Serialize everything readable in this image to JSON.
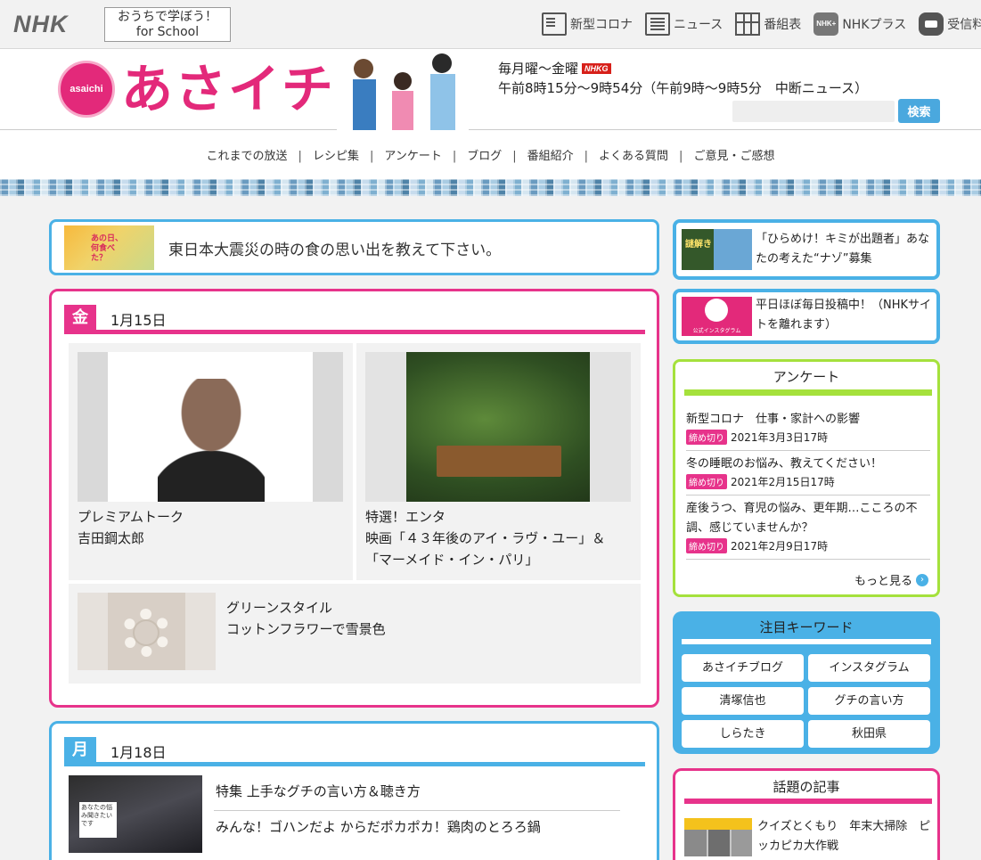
{
  "topbar": {
    "logo": "NHK",
    "school_line1": "おうちで学ぼう！",
    "school_line2": "for School",
    "nav": [
      {
        "label": "新型コロナ",
        "icon": "corona-info-icon"
      },
      {
        "label": "ニュース",
        "icon": "news-icon"
      },
      {
        "label": "番組表",
        "icon": "program-guide-icon"
      },
      {
        "label": "NHKプラス",
        "icon": "nhk-plus-icon"
      },
      {
        "label": "受信料",
        "icon": "reception-fee-icon"
      }
    ],
    "nhk_plus_icon_text": "NHK+"
  },
  "header": {
    "badge_text": "asaichi",
    "title": "あさイチ",
    "air_days": "毎月曜～金曜",
    "channel_badge": "NHKG",
    "air_time": "午前8時15分～9時54分（午前9時～9時5分　中断ニュース）",
    "search_placeholder": "",
    "search_button": "検索"
  },
  "global_nav": [
    "これまでの放送",
    "レシピ集",
    "アンケート",
    "ブログ",
    "番組紹介",
    "よくある質問",
    "ご意見・ご感想"
  ],
  "banner": {
    "text": "東日本大震災の時の食の思い出を教えて下さい。"
  },
  "friday": {
    "day": "金",
    "date": "1月15日",
    "cards": [
      {
        "line1": "プレミアムトーク",
        "line2": "吉田鋼太郎"
      },
      {
        "line1": "特選！エンタ",
        "line2": "映画「４３年後のアイ・ラヴ・ユー」＆",
        "line3": "「マーメイド・イン・パリ」"
      },
      {
        "line1": "グリーンスタイル",
        "line2": "コットンフラワーで雪景色"
      }
    ]
  },
  "monday": {
    "day": "月",
    "date": "1月18日",
    "items": [
      "特集 上手なグチの言い方＆聴き方",
      "みんな！ゴハンだよ からだポカポカ！鶏肉のとろろ鍋"
    ]
  },
  "side_banners": [
    {
      "text": "「ひらめけ！キミが出題者」あなたの考えた“ナゾ”募集"
    },
    {
      "text": "平日ほぼ毎日投稿中！（NHKサイトを離れます）"
    }
  ],
  "survey": {
    "title": "アンケート",
    "deadline_label": "締め切り",
    "items": [
      {
        "question": "新型コロナ　仕事・家計への影響",
        "deadline": "2021年3月3日17時"
      },
      {
        "question": "冬の睡眠のお悩み、教えてください！",
        "deadline": "2021年2月15日17時"
      },
      {
        "question": "産後うつ、育児の悩み、更年期…こころの不調、感じていませんか？",
        "deadline": "2021年2月9日17時"
      }
    ],
    "more": "もっと見る"
  },
  "keywords": {
    "title": "注目キーワード",
    "items": [
      "あさイチブログ",
      "インスタグラム",
      "清塚信也",
      "グチの言い方",
      "しらたき",
      "秋田県"
    ]
  },
  "topics": {
    "title": "話題の記事",
    "items": [
      {
        "text": "クイズとくもり　年末大掃除　ピッカピカ大作戦"
      }
    ]
  },
  "colors": {
    "accent_pink": "#e7338b",
    "accent_blue": "#4ab1e6",
    "accent_green": "#a5e13c",
    "brand_magenta": "#e3297a"
  }
}
